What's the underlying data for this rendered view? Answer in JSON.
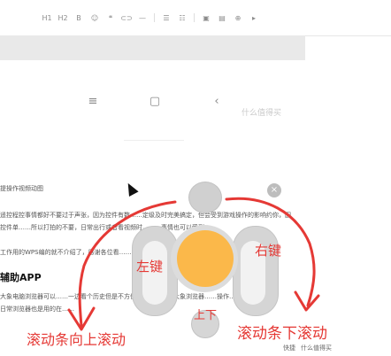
{
  "toolbar": {
    "items": [
      "H1",
      "H2",
      "B",
      "☺",
      "❝",
      "⊂⊃",
      "—",
      "☰",
      "☷",
      "▣",
      "▤",
      "⊕",
      "▸"
    ]
  },
  "phone_nav": {
    "menu": "≡",
    "home": "▢",
    "back": "‹"
  },
  "ghost_search": "什么值得买",
  "article": {
    "line1": "提操作视频动图",
    "line2": "遥控程控事情都好不要过于声张，因为控件有数……定级及时完美搞定，但会受到游戏操作的影响约你，因",
    "line3": "控件单……所以打拍的不要，日常出行或者看视频时，……事情也可以受到。",
    "line4": "工作用的WPS编的就不介绍了，感谢各位看……看",
    "heading": "辅助APP",
    "line5": "大象电脑浏览器可以……一边看个历史但是不方便，但是可以用大象浏览器……操作……",
    "line6": "日常浏览器也是用的在……"
  },
  "controller": {
    "close": "×"
  },
  "annotations": {
    "left_key": "左键",
    "right_key": "右键",
    "up_down": "上下",
    "scroll_up": "滚动条向上滚动",
    "scroll_down": "滚动条下滚动"
  },
  "status": {
    "item1": "快捷",
    "item2": "什么值得买"
  },
  "colors": {
    "annotation": "#e53935",
    "center_button": "#fbb84a"
  }
}
